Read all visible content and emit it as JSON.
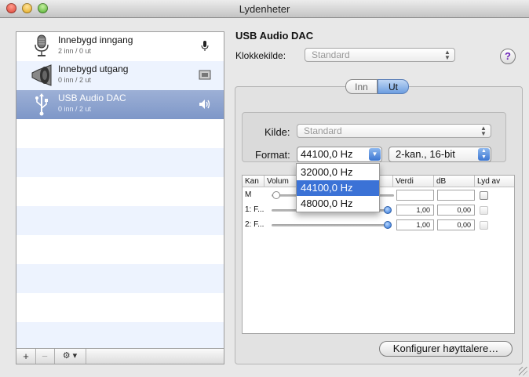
{
  "window": {
    "title": "Lydenheter"
  },
  "devices": [
    {
      "name": "Innebygd inngang",
      "sub": "2 inn / 0 ut",
      "icon": "microphone-icon",
      "status_icon": "mic-status-icon"
    },
    {
      "name": "Innebygd utgang",
      "sub": "0 inn / 2 ut",
      "icon": "speaker-icon",
      "status_icon": "system-output-icon"
    },
    {
      "name": "USB Audio DAC",
      "sub": "0 inn / 2 ut",
      "icon": "usb-icon",
      "status_icon": "speaker-volume-icon"
    }
  ],
  "toolbar": {
    "add": "+",
    "remove": "−",
    "gear": "⚙ ▾"
  },
  "detail": {
    "device_title": "USB Audio DAC",
    "clock_label": "Klokkekilde:",
    "clock_value": "Standard",
    "help": "?",
    "tabs": {
      "inn": "Inn",
      "ut": "Ut",
      "selected": "Ut"
    },
    "source_label": "Kilde:",
    "source_value": "Standard",
    "format_label": "Format:",
    "format_value": "44100,0 Hz",
    "channels_value": "2-kan., 16-bit",
    "format_options": [
      "32000,0 Hz",
      "44100,0 Hz",
      "48000,0 Hz"
    ],
    "format_selected_index": 1
  },
  "table": {
    "headers": [
      "Kan",
      "Volum",
      "Verdi",
      "dB",
      "Lyd av"
    ],
    "rows": [
      {
        "ch": "M",
        "value": "",
        "db": "",
        "level": 0.0
      },
      {
        "ch": "1: F...",
        "value": "1,00",
        "db": "0,00",
        "level": 1.0
      },
      {
        "ch": "2: F...",
        "value": "1,00",
        "db": "0,00",
        "level": 1.0
      }
    ]
  },
  "configure_button": "Konfigurer høyttalere…",
  "colors": {
    "selection": "#3b72d6",
    "row_selected": "#8aa1cd",
    "stripe": "#edf3fe"
  }
}
